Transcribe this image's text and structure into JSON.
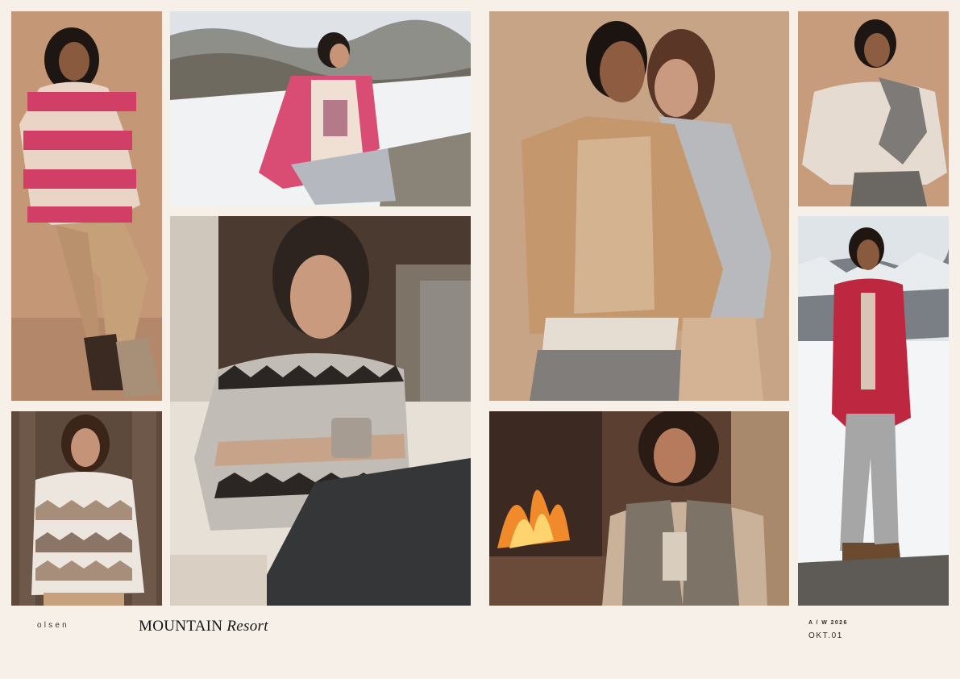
{
  "footer": {
    "brand": "olsen",
    "collection_main": "MOUNTAIN",
    "collection_script": "Resort",
    "season": "A / W 2026",
    "issue": "OKT.01"
  },
  "photos": [
    {
      "id": "p1",
      "subject": "woman-pink-striped-sweater"
    },
    {
      "id": "p2",
      "subject": "woman-pink-quilted-jacket-snow"
    },
    {
      "id": "p3",
      "subject": "two-women-suede-jacket"
    },
    {
      "id": "p4",
      "subject": "woman-colorblock-sweater"
    },
    {
      "id": "p5",
      "subject": "woman-zigzag-knit-cardigan"
    },
    {
      "id": "p6",
      "subject": "woman-fairisle-sweater-mug"
    },
    {
      "id": "p7",
      "subject": "woman-quilted-vest-fireplace"
    },
    {
      "id": "p8",
      "subject": "woman-red-quilted-jacket-lake"
    }
  ],
  "colors": {
    "page_background": "#f6f0e8",
    "accent_pink": "#d4436a",
    "accent_red": "#b8233a",
    "camel": "#c9a27c"
  }
}
